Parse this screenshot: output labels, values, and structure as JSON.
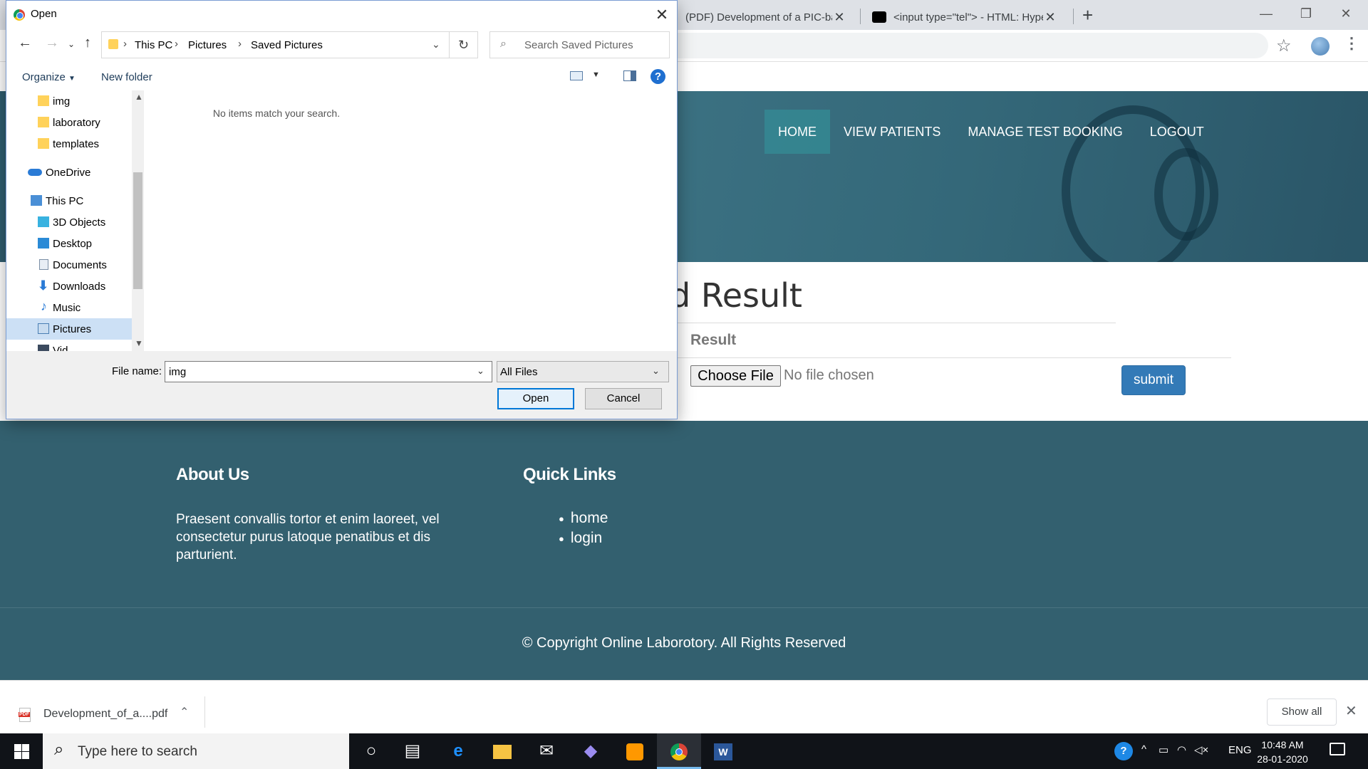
{
  "browser": {
    "tabs": [
      {
        "title": "(PDF) Development of a PIC-base"
      },
      {
        "title": "<input type=\"tel\"> - HTML: Hype"
      }
    ],
    "new_tab": "+"
  },
  "site": {
    "nav": [
      "HOME",
      "VIEW PATIENTS",
      "MANAGE TEST BOOKING",
      "LOGOUT"
    ],
    "heading": "d Result",
    "result_label": "Result",
    "choose_file": "Choose File",
    "no_file": "No file chosen",
    "submit": "submit",
    "footer": {
      "about_title": "About Us",
      "about_text": "Praesent convallis tortor et enim laoreet, vel consectetur purus latoque penatibus et dis parturient.",
      "links_title": "Quick Links",
      "links": [
        "home",
        "login"
      ],
      "copyright": "© Copyright Online Laborotory. All Rights Reserved"
    }
  },
  "downloads": {
    "file_name": "Development_of_a....pdf",
    "show_all": "Show all"
  },
  "dialog": {
    "title": "Open",
    "breadcrumb": [
      "This PC",
      "Pictures",
      "Saved Pictures"
    ],
    "search_placeholder": "Search Saved Pictures",
    "organize": "Organize",
    "new_folder": "New folder",
    "tree": [
      {
        "label": "img",
        "icon": "folder-icon"
      },
      {
        "label": "laboratory",
        "icon": "folder-icon"
      },
      {
        "label": "templates",
        "icon": "folder-icon"
      },
      {
        "label": "OneDrive",
        "icon": "onedrive-icon"
      },
      {
        "label": "This PC",
        "icon": "pc-icon"
      },
      {
        "label": "3D Objects",
        "icon": "cube-icon"
      },
      {
        "label": "Desktop",
        "icon": "desktop-icon"
      },
      {
        "label": "Documents",
        "icon": "documents-icon"
      },
      {
        "label": "Downloads",
        "icon": "downloads-icon"
      },
      {
        "label": "Music",
        "icon": "music-icon"
      },
      {
        "label": "Pictures",
        "icon": "pictures-icon"
      },
      {
        "label": "Vid",
        "icon": "videos-icon"
      }
    ],
    "empty_message": "No items match your search.",
    "file_name_label": "File name:",
    "file_name_value": "img",
    "file_type": "All Files",
    "open_button": "Open",
    "cancel_button": "Cancel"
  },
  "taskbar": {
    "search_placeholder": "Type here to search",
    "language": "ENG",
    "time": "10:48 AM",
    "date": "28-01-2020"
  },
  "colors": {
    "footer_bg": "#33606f",
    "submit_bg": "#337ab7",
    "nav_active": "#348c96"
  }
}
